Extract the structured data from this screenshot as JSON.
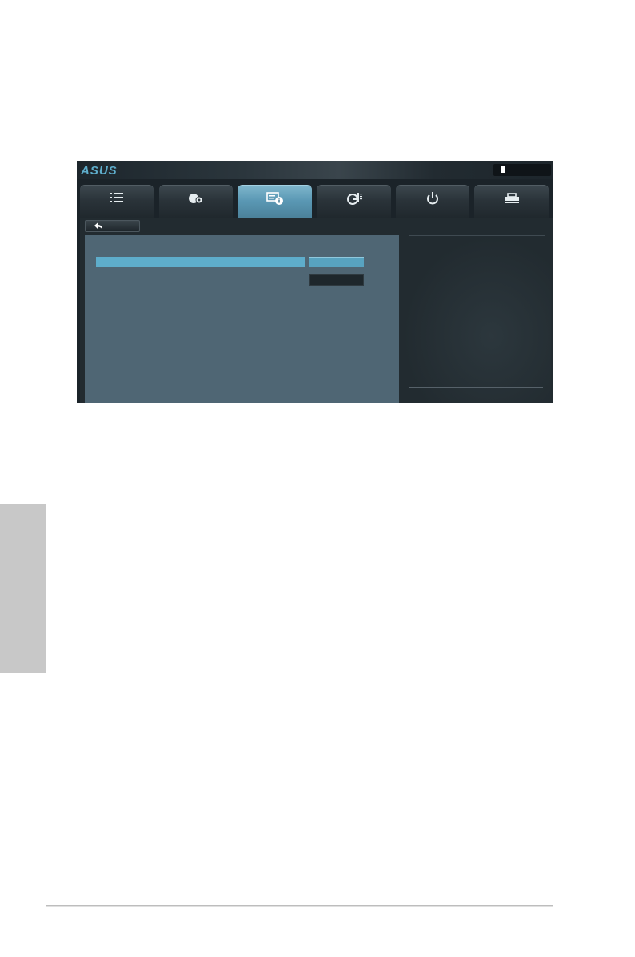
{
  "bios": {
    "brand": "ASUS",
    "accent_color": "#5eadcb",
    "tabs": [
      {
        "icon": "list-icon",
        "active": false
      },
      {
        "icon": "ai-tweaker-icon",
        "active": false
      },
      {
        "icon": "advanced-info-icon",
        "active": true
      },
      {
        "icon": "monitor-icon",
        "active": false
      },
      {
        "icon": "power-icon",
        "active": false
      },
      {
        "icon": "tool-icon",
        "active": false
      }
    ],
    "exit_icon": "exit-door-icon",
    "back_icon": "back-arrow-icon"
  }
}
